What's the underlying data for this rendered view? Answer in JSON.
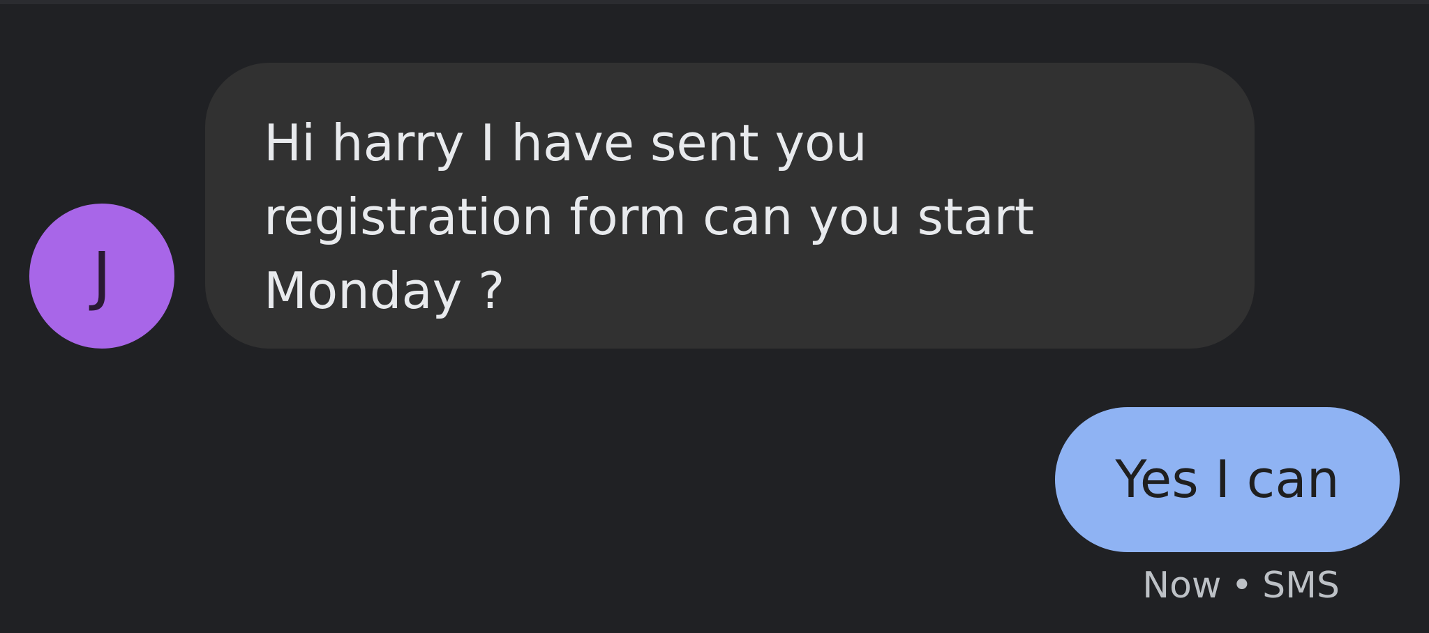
{
  "conversation": {
    "incoming": {
      "avatar_initial": "J",
      "avatar_color": "#a866e8",
      "bubble_color": "#313131",
      "text": "Hi harry I have sent you registration form can you start Monday ?"
    },
    "outgoing": {
      "bubble_color": "#8fb3f3",
      "text": "Yes I can",
      "timestamp": "Now",
      "separator": "•",
      "channel": "SMS"
    }
  }
}
